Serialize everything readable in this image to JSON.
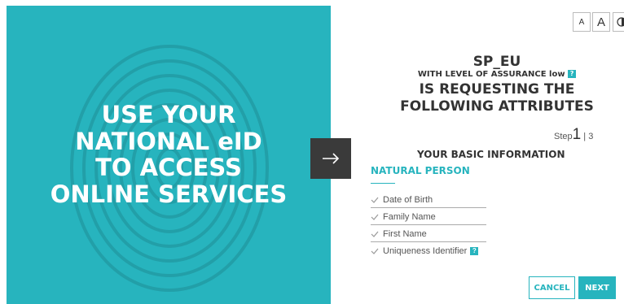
{
  "hero": {
    "lines": [
      "USE YOUR",
      "NATIONAL  eID",
      "TO ACCESS",
      "ONLINE SERVICES"
    ],
    "background_color": "#27b4be"
  },
  "arrow_icon": "arrow-right-icon",
  "accessibility": {
    "small_font": "A",
    "large_font": "A",
    "contrast_icon": "contrast-icon"
  },
  "request": {
    "sp_name": "SP_EU",
    "assurance_prefix": "WITH LEVEL OF ASSURANCE",
    "assurance_value": "low",
    "info_badge": "?",
    "heading_line1": "IS REQUESTING THE",
    "heading_line2": "FOLLOWING ATTRIBUTES"
  },
  "step": {
    "label": "Step",
    "current": "1",
    "separator": "|",
    "total": "3"
  },
  "section": {
    "title": "YOUR BASIC INFORMATION",
    "subtitle": "NATURAL PERSON"
  },
  "attributes": [
    {
      "label": "Date of Birth"
    },
    {
      "label": "Family Name"
    },
    {
      "label": "First Name"
    },
    {
      "label": "Uniqueness Identifier",
      "info": "?"
    }
  ],
  "buttons": {
    "cancel": "CANCEL",
    "next": "NEXT"
  },
  "accent_color": "#27b4be"
}
